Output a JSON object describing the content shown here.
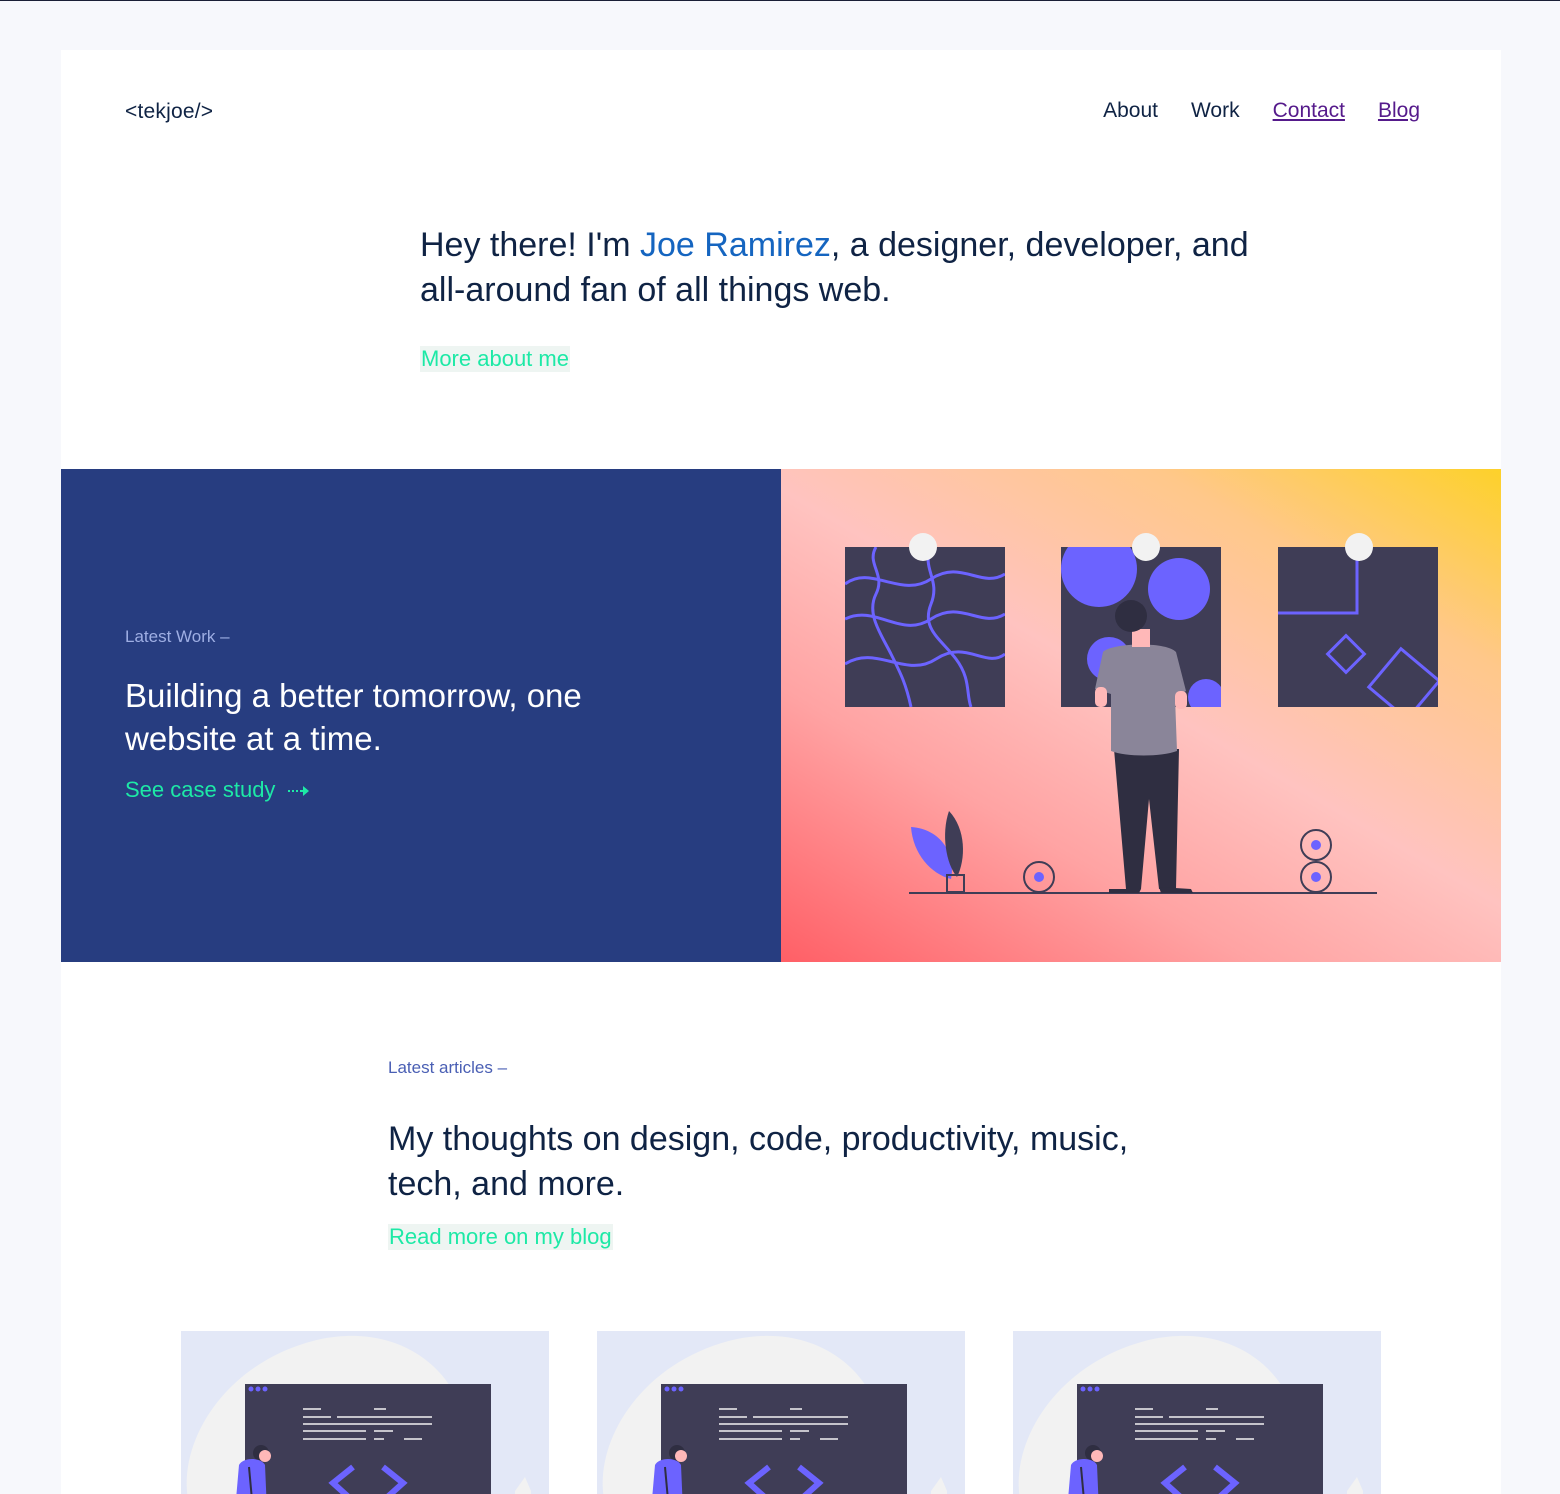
{
  "header": {
    "logo": "<tekjoe/>",
    "nav": [
      {
        "label": "About",
        "visited": false
      },
      {
        "label": "Work",
        "visited": false
      },
      {
        "label": "Contact",
        "visited": true
      },
      {
        "label": "Blog",
        "visited": true
      }
    ]
  },
  "intro": {
    "text_before": "Hey there! I'm ",
    "name": "Joe Ramirez",
    "text_after": ", a designer, developer, and all-around fan of all things web.",
    "link": "More about me"
  },
  "feature": {
    "eyebrow": "Latest Work –",
    "title": "Building a better tomorrow, one website at a time.",
    "link": "See case study",
    "link_icon": "dotted-arrow-right-icon",
    "illustration": "person-viewing-art-gallery-illustration"
  },
  "articles": {
    "eyebrow": "Latest articles –",
    "title": "My thoughts on design, code, productivity, music, tech, and more.",
    "link": "Read more on my blog",
    "cards": [
      {
        "illustration": "developer-code-window-illustration"
      },
      {
        "illustration": "developer-code-window-illustration"
      },
      {
        "illustration": "developer-code-window-illustration"
      }
    ]
  },
  "colors": {
    "background": "#f7f8fc",
    "navy": "#0f2344",
    "feature_blue": "#273d80",
    "accent_green": "#1de9a6",
    "name_blue": "#1565c0",
    "visited_link": "#551a8b",
    "illustration_purple": "#6c63ff",
    "illustration_dark": "#3f3d56"
  }
}
